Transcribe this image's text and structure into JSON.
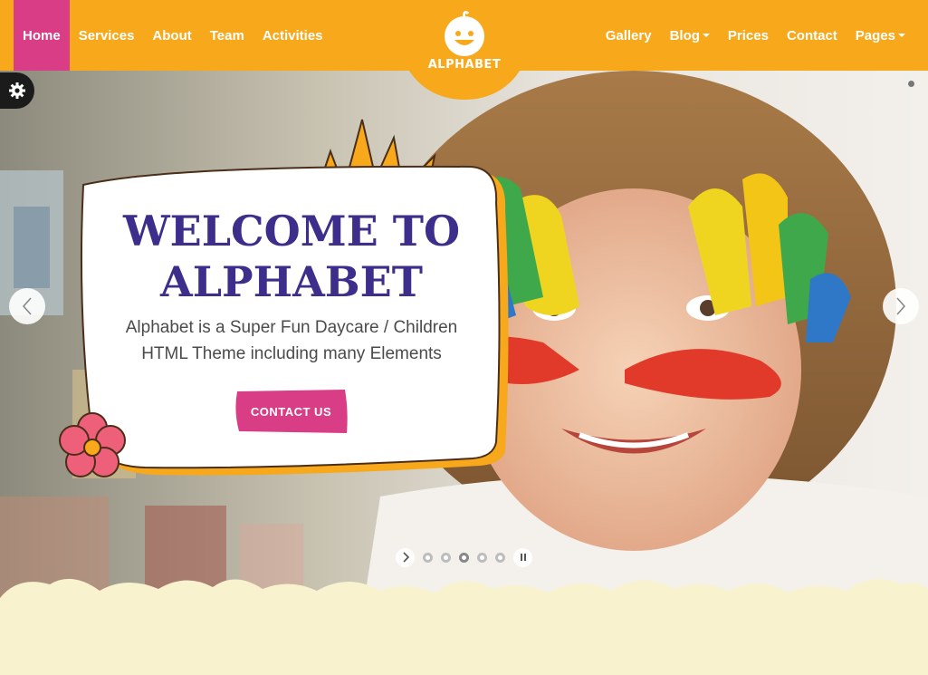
{
  "nav_left": [
    {
      "label": "Home",
      "active": true
    },
    {
      "label": "Services"
    },
    {
      "label": "About"
    },
    {
      "label": "Team"
    },
    {
      "label": "Activities"
    }
  ],
  "nav_right": [
    {
      "label": "Gallery"
    },
    {
      "label": "Blog",
      "dropdown": true
    },
    {
      "label": "Prices"
    },
    {
      "label": "Contact"
    },
    {
      "label": "Pages",
      "dropdown": true
    }
  ],
  "logo": {
    "text": "ALPHABET"
  },
  "hero": {
    "title_line1": "WELCOME TO",
    "title_line2": "ALPHABET",
    "subtitle_line1": "Alphabet is a Super Fun Daycare / Children",
    "subtitle_line2": "HTML Theme including many Elements",
    "cta_label": "CONTACT US"
  },
  "slider": {
    "slide_count": 5,
    "active_slide": 3
  },
  "colors": {
    "header": "#f7a81b",
    "nav_active": "#d93d85",
    "title": "#3d2e8c",
    "cta": "#d93d85",
    "footer_bg": "#f8f2cf"
  },
  "icons": {
    "settings": "gear-icon",
    "prev": "chevron-left-icon",
    "next": "chevron-right-icon",
    "pager_next": "chevron-right-icon",
    "pager_pause": "pause-icon"
  }
}
